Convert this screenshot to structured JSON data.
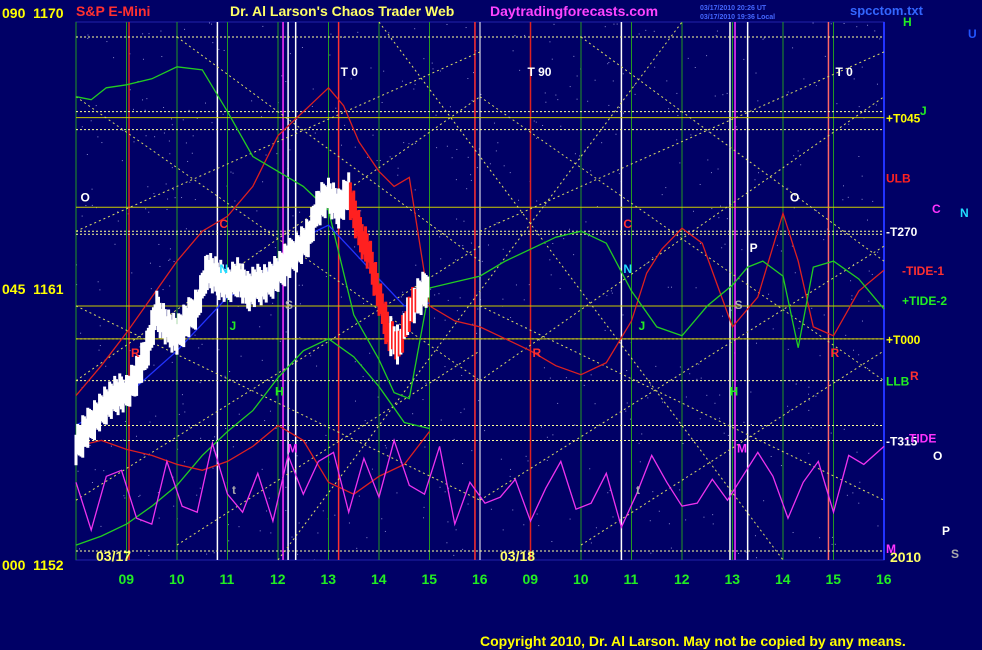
{
  "chart_data": {
    "type": "line",
    "title": "S&P E-Mini",
    "subtitle": "Dr. Al Larson's Chaos Trader Web",
    "site": "Daytradingforecasts.com",
    "source_file": "spcctom.txt",
    "timestamps": [
      "03/17/2010 20:26 UT",
      "03/17/2010 19:36 Local"
    ],
    "copyright": "Copyright 2010, Dr. Al Larson. May not be copied by any means.",
    "year": "2010",
    "ylim": [
      1152,
      1170
    ],
    "y_axis_labels": [
      {
        "text": "090  1170",
        "value": 1170
      },
      {
        "text": "045  1161",
        "value": 1161
      },
      {
        "text": "000  1152",
        "value": 1152
      }
    ],
    "day_labels": [
      "03/17",
      "03/18"
    ],
    "x_hours": [
      [
        "09",
        "10",
        "11",
        "12",
        "13",
        "14",
        "15",
        "16"
      ],
      [
        "09",
        "10",
        "11",
        "12",
        "13",
        "14",
        "15",
        "16"
      ]
    ],
    "grid": true,
    "colors": {
      "background": "#000066",
      "price_up": "#ffffff",
      "price_down": "#ff2020",
      "red_line": "#dd2020",
      "green_line": "#22cc22",
      "blue_line": "#2233ff",
      "tide_osc": "#ee33ee",
      "level_dotted": "#ffff99",
      "hour_grid": "#229922",
      "title": "#ff3030",
      "subtitle": "#ffff66",
      "site": "#ff44ff",
      "copyright": "#ffff00"
    },
    "right_labels": [
      {
        "text": "+T045",
        "value": 1166.8,
        "color": "#ffff00"
      },
      {
        "text": "ULB",
        "value": 1164.8,
        "color": "#ff2020"
      },
      {
        "text": "-T270",
        "value": 1163.0,
        "color": "#ffffff"
      },
      {
        "text": "-TIDE-1",
        "value": 1161.7,
        "color": "#ff3030"
      },
      {
        "text": "+TIDE-2",
        "value": 1160.7,
        "color": "#22ee22"
      },
      {
        "text": "+T000",
        "value": 1159.4,
        "color": "#ffff00"
      },
      {
        "text": "LLB",
        "value": 1158.0,
        "color": "#22ee22"
      },
      {
        "text": "-T315",
        "value": 1156.0,
        "color": "#ffffff"
      },
      {
        "text": "-TIDE",
        "value": 1156.1,
        "color": "#ff33ff"
      }
    ],
    "far_right_markers": [
      {
        "text": "H",
        "color": "#22ee22"
      },
      {
        "text": "U",
        "color": "#2255ff"
      },
      {
        "text": "J",
        "color": "#22ee22"
      },
      {
        "text": "C",
        "color": "#ff33ff"
      },
      {
        "text": "N",
        "color": "#22ddff"
      },
      {
        "text": "R",
        "color": "#ff3030"
      },
      {
        "text": "O",
        "color": "#ffffff"
      },
      {
        "text": "P",
        "color": "#ffffff"
      },
      {
        "text": "S",
        "color": "#aaaaaa"
      },
      {
        "text": "M",
        "color": "#ff33ff"
      }
    ],
    "planet_markers": [
      {
        "text": "T 0",
        "x": 5.2,
        "color": "#ffffff"
      },
      {
        "text": "T 90",
        "x": 8.9,
        "color": "#ffffff"
      },
      {
        "text": "T 0",
        "x": 15.0,
        "color": "#ffffff"
      },
      {
        "text": "O",
        "x": 0.05,
        "color": "#ffffff"
      },
      {
        "text": "O",
        "x": 5.18,
        "color": "#ffffff"
      },
      {
        "text": "O",
        "x": 14.1,
        "color": "#ffffff"
      },
      {
        "text": "C",
        "x": 2.8,
        "color": "#ff3030"
      },
      {
        "text": "C",
        "x": 10.8,
        "color": "#ff3030"
      },
      {
        "text": "N",
        "x": 2.8,
        "color": "#22ddff"
      },
      {
        "text": "N",
        "x": 10.8,
        "color": "#22ddff"
      },
      {
        "text": "P",
        "x": 4.3,
        "color": "#ffffff"
      },
      {
        "text": "P",
        "x": 13.3,
        "color": "#ffffff"
      },
      {
        "text": "S",
        "x": 4.1,
        "color": "#aaaaaa"
      },
      {
        "text": "S",
        "x": 13.0,
        "color": "#aaaaaa"
      },
      {
        "text": "R",
        "x": 1.05,
        "color": "#ff3030"
      },
      {
        "text": "R",
        "x": 9.0,
        "color": "#ff3030"
      },
      {
        "text": "R",
        "x": 14.9,
        "color": "#ff3030"
      },
      {
        "text": "J",
        "x": 3.0,
        "color": "#22ee22"
      },
      {
        "text": "J",
        "x": 11.1,
        "color": "#22ee22"
      },
      {
        "text": "H",
        "x": 3.9,
        "color": "#22ee22"
      },
      {
        "text": "H",
        "x": 12.9,
        "color": "#22ee22"
      },
      {
        "text": "M",
        "x": 4.15,
        "color": "#ff33ff"
      },
      {
        "text": "M",
        "x": 13.05,
        "color": "#ff33ff"
      },
      {
        "text": "t",
        "x": 3.05,
        "color": "#aaaaaa"
      },
      {
        "text": "t",
        "x": 11.05,
        "color": "#aaaaaa"
      }
    ],
    "series": [
      {
        "name": "price",
        "x": [
          0.0,
          0.2,
          0.4,
          0.6,
          0.8,
          1.0,
          1.2,
          1.4,
          1.6,
          1.8,
          2.0,
          2.2,
          2.4,
          2.6,
          2.8,
          3.0,
          3.2,
          3.4,
          3.6,
          3.8,
          4.0,
          4.2,
          4.4,
          4.6,
          4.8,
          5.0,
          5.2,
          5.4,
          5.6,
          5.8,
          6.0,
          6.2,
          6.4,
          6.6,
          6.8,
          7.0
        ],
        "y": [
          1155.8,
          1156.3,
          1156.8,
          1157.2,
          1157.5,
          1157.6,
          1158.2,
          1159.0,
          1160.3,
          1159.8,
          1159.5,
          1160.0,
          1160.5,
          1161.7,
          1161.4,
          1161.2,
          1161.5,
          1161.0,
          1161.2,
          1161.3,
          1161.6,
          1162.0,
          1162.4,
          1162.8,
          1163.8,
          1164.2,
          1163.8,
          1164.3,
          1163.0,
          1162.3,
          1160.8,
          1159.5,
          1159.2,
          1160.3,
          1160.8,
          1161.2
        ]
      },
      {
        "name": "red_line",
        "x": [
          0.0,
          0.5,
          1.0,
          1.5,
          2.0,
          2.5,
          3.0,
          3.5,
          4.0,
          4.5,
          5.0,
          5.3,
          5.6,
          6.0,
          6.3,
          6.6,
          7.0,
          7.5,
          8.0,
          8.5,
          9.0,
          9.5,
          10.0,
          10.5,
          11.0,
          11.3,
          11.6,
          12.0,
          12.4,
          12.7,
          13.0,
          13.5,
          14.0,
          14.3,
          14.6,
          15.0,
          15.5,
          16.0
        ],
        "y": [
          1157.5,
          1158.5,
          1159.6,
          1160.8,
          1162.0,
          1163.0,
          1163.5,
          1164.5,
          1166.2,
          1167.0,
          1167.8,
          1167.2,
          1166.0,
          1165.0,
          1164.5,
          1164.8,
          1160.5,
          1160.0,
          1159.8,
          1159.4,
          1159.0,
          1158.5,
          1158.2,
          1158.6,
          1160.0,
          1161.6,
          1162.4,
          1163.1,
          1162.6,
          1161.2,
          1159.8,
          1160.8,
          1163.6,
          1162.0,
          1159.8,
          1159.5,
          1161.0,
          1161.7
        ]
      },
      {
        "name": "green_line",
        "x": [
          0.0,
          0.3,
          0.6,
          1.0,
          1.5,
          2.0,
          2.5,
          3.0,
          3.5,
          4.0,
          4.5,
          5.0,
          5.5,
          6.0,
          6.3,
          6.6,
          7.0,
          7.5,
          8.0,
          8.5,
          9.0,
          9.5,
          10.0,
          10.5,
          11.0,
          11.5,
          12.0,
          12.5,
          13.0,
          13.3,
          13.6,
          14.0,
          14.3,
          14.6,
          15.0,
          15.5,
          16.0
        ],
        "y": [
          1167.5,
          1167.4,
          1167.8,
          1167.9,
          1168.1,
          1168.5,
          1168.4,
          1167.0,
          1165.5,
          1165.0,
          1164.5,
          1163.7,
          1160.2,
          1158.7,
          1157.6,
          1157.4,
          1161.1,
          1161.3,
          1161.5,
          1162.0,
          1162.4,
          1162.8,
          1163.0,
          1162.6,
          1161.0,
          1159.8,
          1159.5,
          1160.5,
          1161.2,
          1161.8,
          1162.0,
          1161.5,
          1159.1,
          1161.8,
          1162.0,
          1161.4,
          1160.4
        ]
      },
      {
        "name": "green_line_low",
        "x": [
          0.0,
          0.5,
          1.0,
          1.5,
          2.0,
          2.5,
          3.0,
          3.5,
          4.0,
          4.5,
          5.0,
          5.5,
          6.0,
          6.5,
          7.0
        ],
        "y": [
          1152.5,
          1152.8,
          1153.2,
          1153.8,
          1154.5,
          1155.5,
          1156.3,
          1157.0,
          1158.1,
          1159.0,
          1159.4,
          1158.8,
          1157.8,
          1156.6,
          1156.4
        ]
      },
      {
        "name": "blue_line",
        "x": [
          0.0,
          1.0,
          2.0,
          3.0,
          3.5,
          4.0,
          4.5,
          5.0,
          5.5,
          6.0,
          6.5,
          7.0
        ],
        "y": [
          1156.5,
          1157.5,
          1159.0,
          1160.8,
          1161.2,
          1162.0,
          1162.8,
          1163.2,
          1162.3,
          1161.4,
          1160.5,
          1160.6
        ]
      },
      {
        "name": "red_line_low",
        "x": [
          0.0,
          0.5,
          1.0,
          1.5,
          2.0,
          2.5,
          3.0,
          3.5,
          4.0,
          4.5,
          5.0,
          5.5,
          6.0,
          6.5,
          7.0
        ],
        "y": [
          1155.8,
          1156.0,
          1155.7,
          1155.5,
          1155.2,
          1155.0,
          1155.3,
          1155.8,
          1156.5,
          1156.0,
          1154.6,
          1154.2,
          1154.8,
          1155.2,
          1156.3
        ]
      },
      {
        "name": "tide_oscillator",
        "x": [
          0.0,
          0.3,
          0.6,
          0.9,
          1.2,
          1.5,
          1.8,
          2.1,
          2.4,
          2.7,
          3.0,
          3.3,
          3.6,
          3.9,
          4.2,
          4.5,
          4.8,
          5.1,
          5.4,
          5.7,
          6.0,
          6.3,
          6.6,
          6.9,
          7.2,
          7.5,
          7.8,
          8.1,
          8.4,
          8.7,
          9.0,
          9.3,
          9.6,
          9.9,
          10.2,
          10.5,
          10.8,
          11.1,
          11.4,
          11.7,
          12.0,
          12.3,
          12.6,
          12.9,
          13.2,
          13.5,
          13.8,
          14.1,
          14.4,
          14.7,
          15.0,
          15.3,
          15.6,
          16.0
        ],
        "y": [
          1154.6,
          1153.0,
          1154.8,
          1155.0,
          1153.4,
          1153.2,
          1155.3,
          1153.8,
          1153.6,
          1155.9,
          1154.2,
          1153.6,
          1154.9,
          1153.3,
          1155.5,
          1154.2,
          1155.3,
          1155.6,
          1153.6,
          1155.4,
          1154.1,
          1156.0,
          1154.5,
          1154.2,
          1155.8,
          1153.2,
          1154.6,
          1153.9,
          1154.1,
          1154.7,
          1153.3,
          1154.4,
          1155.3,
          1153.7,
          1153.9,
          1154.9,
          1153.1,
          1154.2,
          1155.5,
          1154.6,
          1153.8,
          1153.9,
          1154.7,
          1154.0,
          1154.8,
          1155.6,
          1154.8,
          1153.4,
          1154.6,
          1155.3,
          1153.6,
          1155.5,
          1155.2,
          1155.8
        ]
      }
    ]
  }
}
